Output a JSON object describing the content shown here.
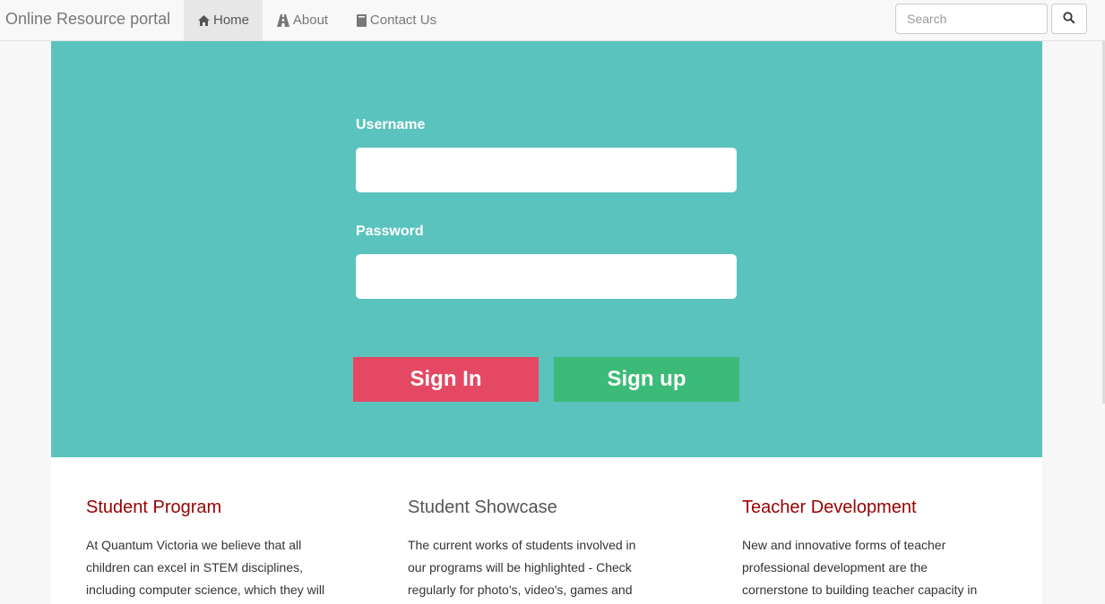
{
  "navbar": {
    "brand": "Online Resource portal",
    "items": [
      {
        "label": "Home",
        "icon": "home-icon",
        "active": true
      },
      {
        "label": "About",
        "icon": "road-icon",
        "active": false
      },
      {
        "label": "Contact Us",
        "icon": "book-icon",
        "active": false
      }
    ],
    "search": {
      "placeholder": "Search",
      "value": ""
    },
    "search_button_icon": "search-icon"
  },
  "login": {
    "username_label": "Username",
    "username_value": "",
    "password_label": "Password",
    "password_value": "",
    "signin_label": "Sign In",
    "signup_label": "Sign up"
  },
  "colors": {
    "hero": "#5bc3bd",
    "signin": "#e44862",
    "signup": "#3bbb77",
    "heading_red": "#990000"
  },
  "sections": [
    {
      "title": "Student Program",
      "lines": [
        "At Quantum Victoria we believe that all",
        "children can excel in STEM disciplines,",
        "including computer science, which they will"
      ]
    },
    {
      "title": "Student Showcase",
      "lines": [
        "The current works of students involved in",
        "our programs will be highlighted - Check",
        "regularly for photo's, video's, games and"
      ]
    },
    {
      "title": "Teacher Development",
      "lines": [
        "New and innovative forms of teacher",
        "professional development are the",
        "cornerstone to building teacher capacity in"
      ]
    }
  ]
}
